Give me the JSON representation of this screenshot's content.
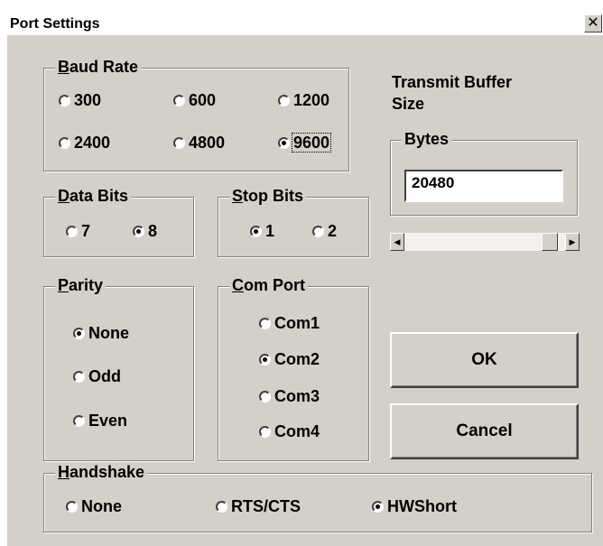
{
  "window": {
    "title": "Port Settings",
    "close_glyph": "✕"
  },
  "baud_rate": {
    "legend_key": "B",
    "legend_rest": "aud Rate",
    "options": [
      "300",
      "600",
      "1200",
      "2400",
      "4800",
      "9600"
    ],
    "selected": "9600"
  },
  "data_bits": {
    "legend_key": "D",
    "legend_rest": "ata Bits",
    "options": [
      "7",
      "8"
    ],
    "selected": "8"
  },
  "stop_bits": {
    "legend_key": "S",
    "legend_rest": "top Bits",
    "options": [
      "1",
      "2"
    ],
    "selected": "1"
  },
  "parity": {
    "legend_key": "P",
    "legend_rest": "arity",
    "options": [
      "None",
      "Odd",
      "Even"
    ],
    "selected": "None"
  },
  "com_port": {
    "legend_key": "C",
    "legend_rest": "om Port",
    "options": [
      "Com1",
      "Com2",
      "Com3",
      "Com4"
    ],
    "selected": "Com2"
  },
  "handshake": {
    "legend_key": "H",
    "legend_rest": "andshake",
    "options": [
      "None",
      "RTS/CTS",
      "HWShort"
    ],
    "selected": "HWShort"
  },
  "transmit_buffer": {
    "label_line1": "Transmit Buffer",
    "label_line2": "Size",
    "bytes_legend": "Bytes",
    "value": "20480",
    "scroll_left_glyph": "◀",
    "scroll_right_glyph": "▶",
    "scroll_position": 0.95
  },
  "buttons": {
    "ok": "OK",
    "cancel": "Cancel"
  }
}
